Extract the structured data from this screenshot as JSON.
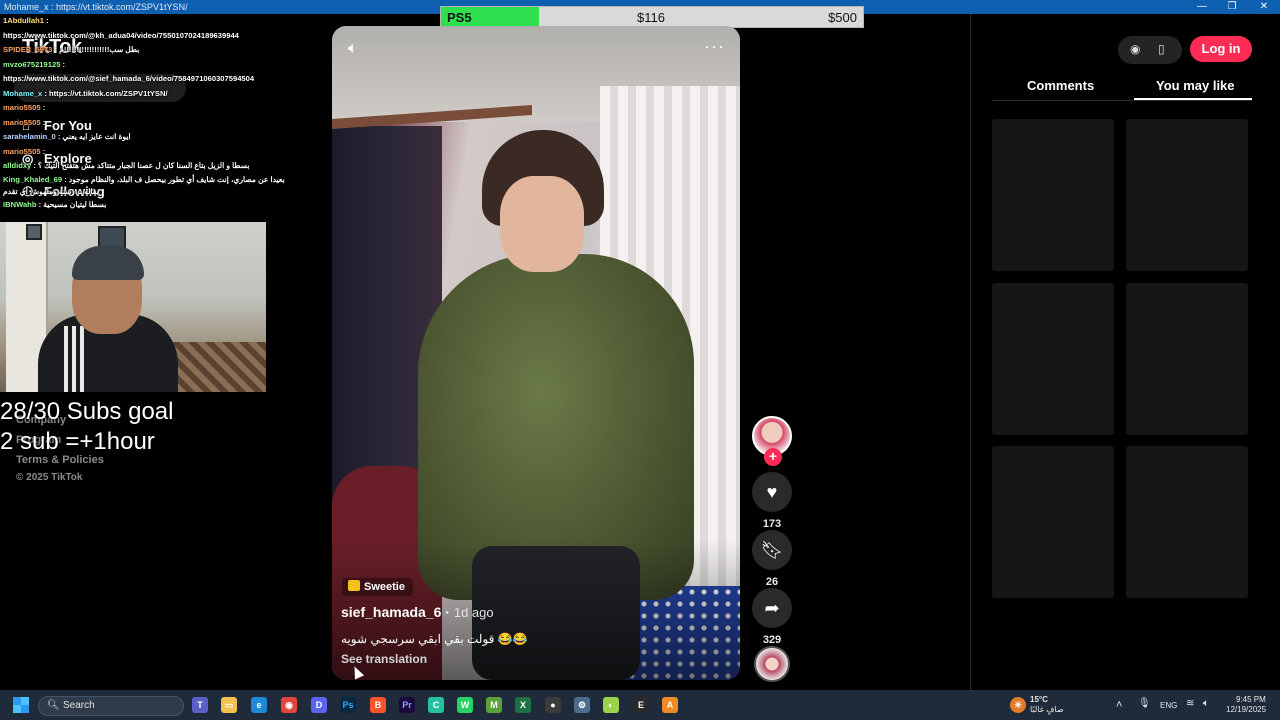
{
  "window": {
    "title_fragment": "Mohame_x : https://vt.tiktok.com/ZSPV1tYSN/",
    "controls": [
      "—",
      "❐",
      "✕"
    ]
  },
  "goal_bar": {
    "label": "PS5",
    "current": "$116",
    "target": "$500",
    "fill_fraction": 0.232
  },
  "tiktok_sidebar": {
    "logo": "TikTok",
    "nav": [
      {
        "icon": "home-icon",
        "label": "For You"
      },
      {
        "icon": "compass-icon",
        "label": "Explore"
      },
      {
        "icon": "following-icon",
        "label": "Following"
      }
    ],
    "footer": [
      "Company",
      "Program",
      "Terms & Policies",
      "© 2025 TikTok"
    ]
  },
  "chat": [
    {
      "user": "1Abdullah1",
      "color": "yellow",
      "text": ":"
    },
    {
      "user": "",
      "color": "",
      "text": "https://www.tiktok.com/@kh_adua04/video/7550107024189639944"
    },
    {
      "user": "SPIDER_5973",
      "color": "orange",
      "text": ": بطل سب!!!!!!!!!!!!!!!!!!م"
    },
    {
      "user": "mvzo675219125",
      "color": "green",
      "text": ":"
    },
    {
      "user": "",
      "color": "",
      "text": "https://www.tiktok.com/@sief_hamada_6/video/7584971060307594504"
    },
    {
      "user": "Mohame_x",
      "color": "cyan",
      "text": ": https://vt.tiktok.com/ZSPV1tYSN/"
    },
    {
      "user": "mario5505",
      "color": "orange",
      "text": ":"
    },
    {
      "user": "mario5505",
      "color": "orange",
      "text": ":"
    },
    {
      "user": "sarahelamin_0",
      "color": "",
      "text": ": ايوة انت عايز ايه يعني"
    },
    {
      "user": "mario5505",
      "color": "orange",
      "text": ":"
    },
    {
      "user": "alldidxy",
      "color": "green",
      "text": ": بسطا و الزيل بتاع السنا كان ل عصنا الجبار متتاكد مش هتقتح التيك ؟"
    },
    {
      "user": "King_Khaled_69",
      "color": "green",
      "text": ": بعيدا عن مصاري، إنت شايف أي تطور بيحصل ف البلد، والنظام موجود بقاله ١٥ سنة وملهوش أي تقدم",
      "two": true
    },
    {
      "user": "IBNWahb",
      "color": "green",
      "text": ": بسطا ليتيان مسيحية"
    }
  ],
  "stream_overlay": {
    "goal_line1": "28/30 Subs goal",
    "goal_line2": "2 sub =+1hour"
  },
  "video": {
    "tag": "Sweetie",
    "author": "sief_hamada_6",
    "age": "1d ago",
    "caption": "قولت بقي ابقي سرسجي شويه 😂😂",
    "see_translation": "See translation",
    "icons": {
      "mute": "volume-icon",
      "more": "more-icon"
    }
  },
  "actions": {
    "likes": "173",
    "saves": "26",
    "shares": "329"
  },
  "right_panel": {
    "login": "Log in",
    "tabs": [
      "Comments",
      "You may like"
    ],
    "active_tab": "You may like",
    "thumbnail_count": 6
  },
  "taskbar": {
    "search_placeholder": "Search",
    "weather_temp": "15°C",
    "weather_desc": "صافٍ غالبًا",
    "lang": "ENG",
    "time": "9:45 PM",
    "date": "12/19/2025"
  }
}
